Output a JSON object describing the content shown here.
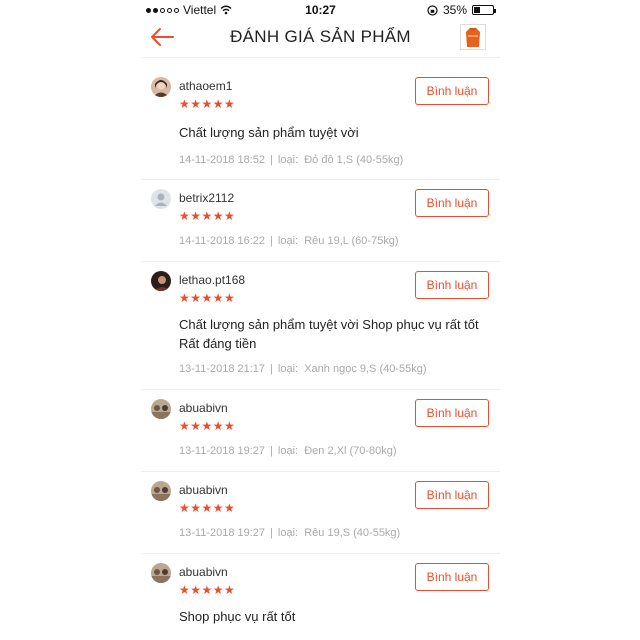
{
  "status_bar": {
    "carrier": "Viettel",
    "time": "10:27",
    "battery": "35%",
    "battery_level": 0.35
  },
  "header": {
    "title": "ĐÁNH GIÁ SẢN PHẨM"
  },
  "comment_label": "Bình luận",
  "stars_text": "★★★★★",
  "type_prefix": "loại:",
  "reviews": [
    {
      "username": "athaoem1",
      "content": "Chất lượng sản phẩm tuyệt vời",
      "date": "14-11-2018 18:52",
      "variant": "Đỏ đô 1,S (40-55kg)"
    },
    {
      "username": "betrix2112",
      "content": "",
      "date": "14-11-2018 16:22",
      "variant": "Rêu 19,L (60-75kg)"
    },
    {
      "username": "lethao.pt168",
      "content": "Chất lượng sản phẩm tuyệt vời Shop phục vụ rất tốt Rất đáng tiền",
      "date": "13-11-2018 21:17",
      "variant": "Xanh ngọc 9,S (40-55kg)"
    },
    {
      "username": "abuabivn",
      "content": "",
      "date": "13-11-2018 19:27",
      "variant": "Đen 2,Xl (70-80kg)"
    },
    {
      "username": "abuabivn",
      "content": "",
      "date": "13-11-2018 19:27",
      "variant": "Rêu 19,S (40-55kg)"
    },
    {
      "username": "abuabivn",
      "content": "Shop phục vụ rất tốt",
      "date": "",
      "variant": ""
    }
  ]
}
